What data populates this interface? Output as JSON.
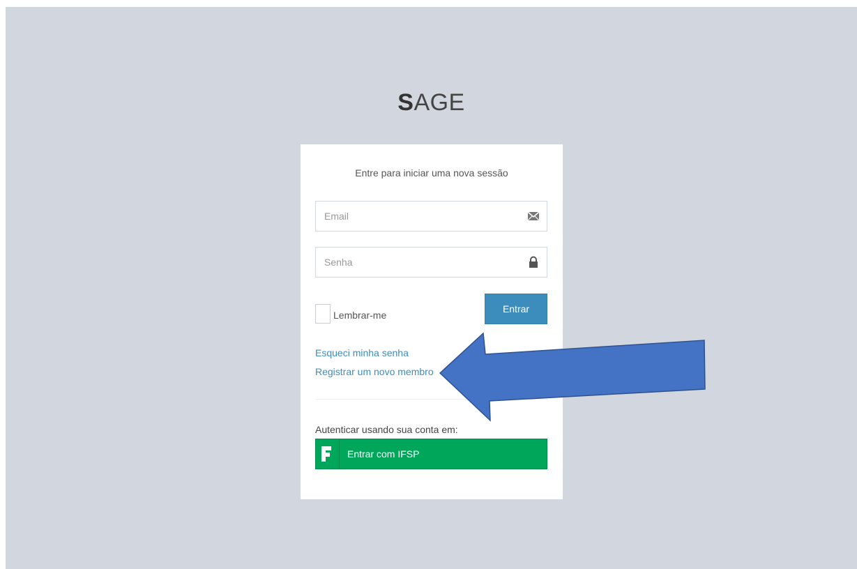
{
  "logo": {
    "bold": "S",
    "rest": "AGE"
  },
  "login": {
    "message": "Entre para iniciar uma nova sessão",
    "email_placeholder": "Email",
    "email_icon": "envelope-icon",
    "password_placeholder": "Senha",
    "password_icon": "lock-icon",
    "remember_label": "Lembrar-me",
    "remember_checked": false,
    "submit_label": "Entrar",
    "forgot_link": "Esqueci minha senha",
    "register_link": "Registrar um novo membro",
    "auth_label": "Autenticar usando sua conta em:",
    "ifsp_button_label": "Entrar com IFSP",
    "ifsp_icon": "ifsp-logo-icon"
  },
  "annotation": {
    "arrow_icon": "arrow-left-icon",
    "arrow_color": "#4472c4"
  },
  "colors": {
    "background": "#d2d6de",
    "primary": "#3c8dbc",
    "success": "#00a65a",
    "link": "#3c8dbc"
  }
}
